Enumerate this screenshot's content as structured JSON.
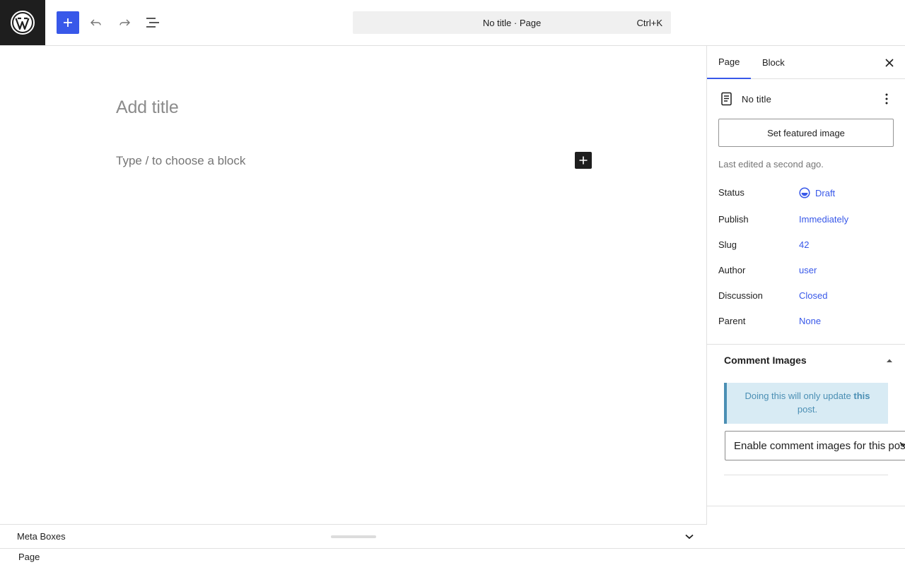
{
  "header": {
    "command_title": "No title · Page",
    "command_shortcut": "Ctrl+K"
  },
  "editor": {
    "title_placeholder": "Add title",
    "block_placeholder": "Type / to choose a block"
  },
  "sidebar": {
    "tabs": [
      {
        "label": "Page",
        "active": true
      },
      {
        "label": "Block",
        "active": false
      }
    ],
    "document_title": "No title",
    "featured_image_label": "Set featured image",
    "last_edited": "Last edited a second ago.",
    "meta": {
      "status": {
        "label": "Status",
        "value": "Draft"
      },
      "publish": {
        "label": "Publish",
        "value": "Immediately"
      },
      "slug": {
        "label": "Slug",
        "value": "42"
      },
      "author": {
        "label": "Author",
        "value": "user"
      },
      "discussion": {
        "label": "Discussion",
        "value": "Closed"
      },
      "parent": {
        "label": "Parent",
        "value": "None"
      }
    },
    "comment_images": {
      "title": "Comment Images",
      "notice_prefix": "Doing this will only update ",
      "notice_bold": "this",
      "notice_suffix": " post.",
      "select_value": "Enable comment images for this post."
    }
  },
  "metaboxes": {
    "label": "Meta Boxes"
  },
  "footer": {
    "breadcrumb": "Page"
  },
  "colors": {
    "accent": "#3858e9",
    "notice_bg": "#d8ebf4",
    "notice_text": "#4b8fb4"
  }
}
